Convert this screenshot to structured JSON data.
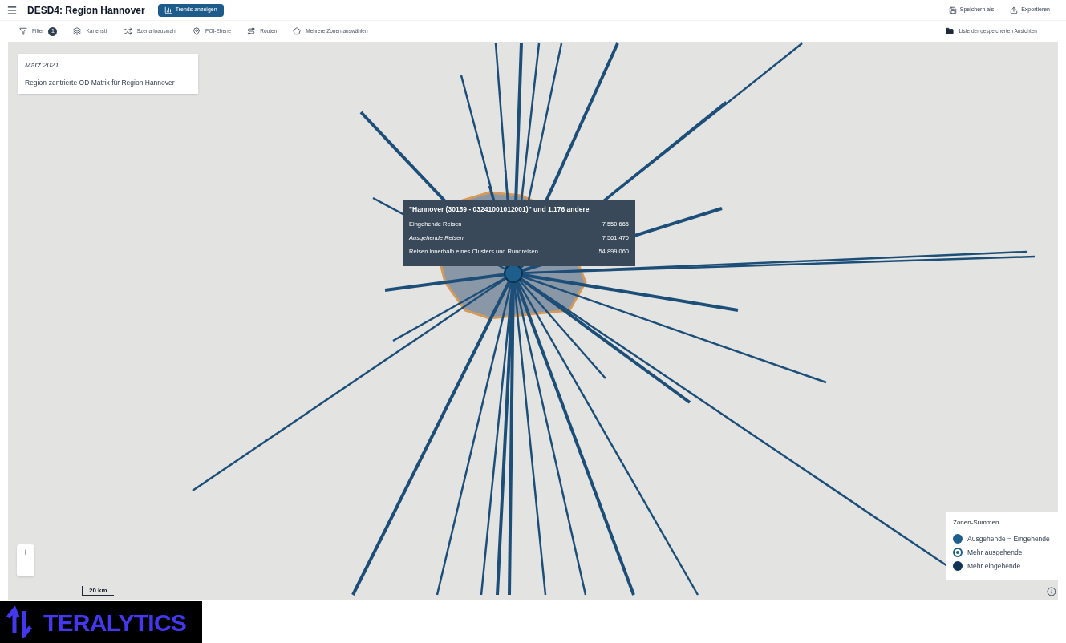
{
  "header": {
    "title": "DESD4: Region Hannover",
    "trend_button": "Trends anzeigen",
    "actions": [
      {
        "kind": "save",
        "label": "Speichern als"
      },
      {
        "kind": "export",
        "label": "Exportieren"
      }
    ]
  },
  "toolbar": {
    "items": [
      {
        "kind": "filter",
        "label": "Filter",
        "badge": "1"
      },
      {
        "kind": "style",
        "label": "Kartenstil"
      },
      {
        "kind": "scenario",
        "label": "Szenarioauswahl"
      },
      {
        "kind": "poi",
        "label": "POI-Ebene"
      },
      {
        "kind": "routes",
        "label": "Routen"
      },
      {
        "kind": "zones",
        "label": "Mehrere Zonen auswählen"
      }
    ],
    "saved_views": "Liste der gespeicherten Ansichten"
  },
  "info_box": {
    "period": "März 2021",
    "description": "Region-zentrierte OD Matrix für Region Hannover"
  },
  "tooltip": {
    "title": "\"Hannover (30159 - 03241001012001)\" und 1.176 andere",
    "rows": [
      {
        "label": "Eingehende Reisen",
        "value": "7.550.665",
        "italic": false
      },
      {
        "label": "Ausgehende Reisen",
        "value": "7.561.470",
        "italic": true
      },
      {
        "label": "Reisen innerhalb eines Clusters und Rundreisen",
        "value": "54.899.060",
        "italic": false
      }
    ]
  },
  "legend": {
    "title": "Zonen-Summen",
    "items": [
      {
        "kind": "equal",
        "label": "Ausgehende = Eingehende",
        "color": "#1d5e8c"
      },
      {
        "kind": "outgoing",
        "label": "Mehr ausgehende",
        "color": "#1d5e8c"
      },
      {
        "kind": "incoming",
        "label": "Mehr eingehende",
        "color": "#0f3355"
      }
    ]
  },
  "zoom": {
    "in": "+",
    "out": "−"
  },
  "scale": "20 km",
  "brand": "TERALYTICS"
}
